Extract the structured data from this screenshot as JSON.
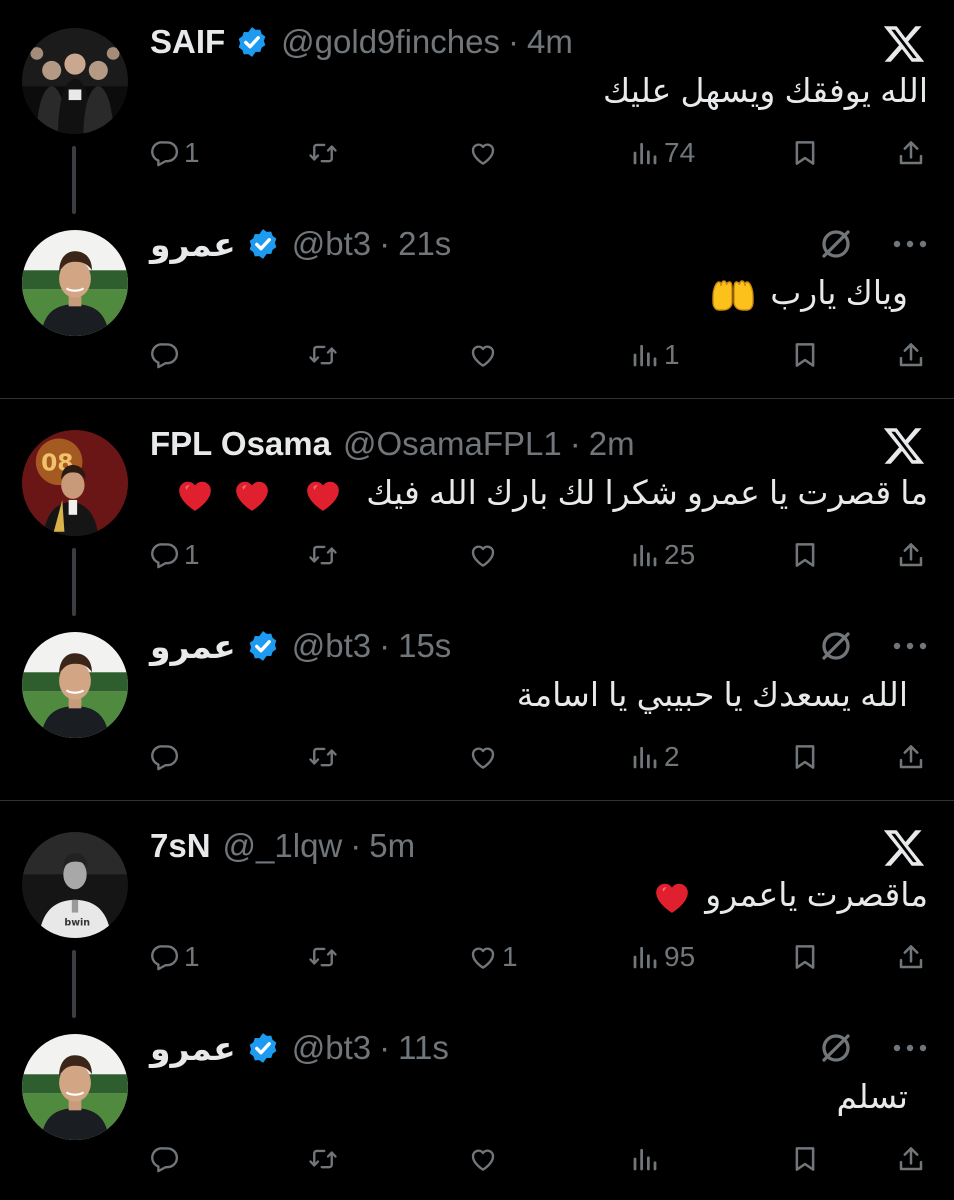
{
  "colors": {
    "background": "#000000",
    "text": "#e7e9ea",
    "muted": "#71767b",
    "verified": "#1d9bf0",
    "divider": "#2f3336",
    "heart": "#e0202e"
  },
  "icons": {
    "reply": "reply-icon",
    "retweet": "retweet-icon",
    "like": "like-icon",
    "views": "views-icon",
    "bookmark": "bookmark-icon",
    "share": "share-icon",
    "brand": "x-logo-icon",
    "edit": "circle-slash-icon",
    "more": "more-icon"
  },
  "threads": [
    {
      "reply": {
        "name": "SAIF",
        "verified": true,
        "handle": "@gold9finches",
        "time": "4m",
        "text": "الله يوفقك ويسهل عليك",
        "replies": "1",
        "retweets": "",
        "likes": "",
        "views": "74"
      },
      "answer": {
        "name": "عمرو",
        "verified": true,
        "handle": "@bt3",
        "time": "21s",
        "text": "وياك يارب",
        "emoji": "🤲",
        "replies": "",
        "retweets": "",
        "likes": "",
        "views": "1"
      }
    },
    {
      "reply": {
        "name": "FPL Osama",
        "verified": false,
        "handle": "@OsamaFPL1",
        "time": "2m",
        "text": "ما قصرت يا عمرو شكرا لك بارك الله فيك",
        "emoji": "❤️❤️❤️",
        "replies": "1",
        "retweets": "",
        "likes": "",
        "views": "25"
      },
      "answer": {
        "name": "عمرو",
        "verified": true,
        "handle": "@bt3",
        "time": "15s",
        "text": "الله يسعدك يا حبيبي يا اسامة",
        "replies": "",
        "retweets": "",
        "likes": "",
        "views": "2"
      }
    },
    {
      "reply": {
        "name": "7sN",
        "verified": false,
        "handle": "@_1lqw",
        "time": "5m",
        "text": "ماقصرت ياعمرو",
        "emoji": "❤️",
        "replies": "1",
        "retweets": "",
        "likes": "1",
        "views": "95"
      },
      "answer": {
        "name": "عمرو",
        "verified": true,
        "handle": "@bt3",
        "time": "11s",
        "text": "تسلم",
        "replies": "",
        "retweets": "",
        "likes": "",
        "views": ""
      }
    }
  ]
}
